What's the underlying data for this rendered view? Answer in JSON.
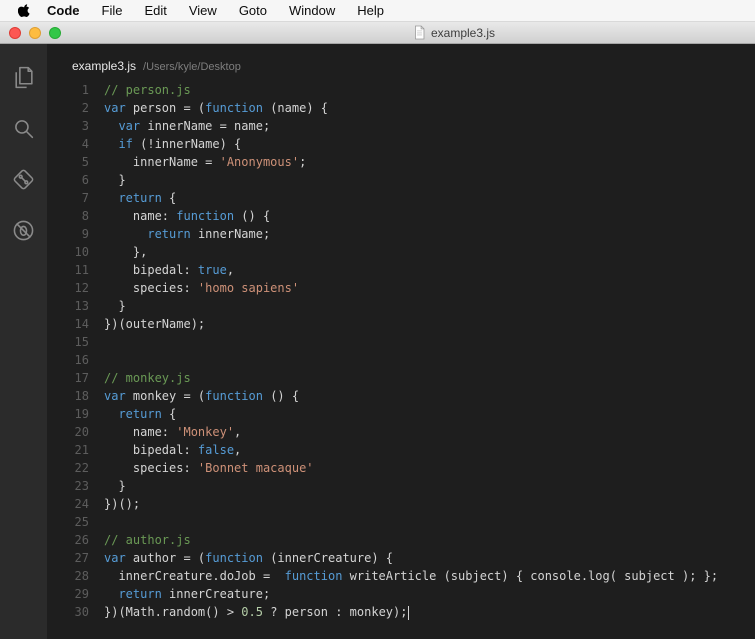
{
  "colors": {
    "editor_bg": "#1e1e1e",
    "activity_bar_bg": "#2b2b2b",
    "line_number": "#5d5d5d",
    "plain": "#d4d4d4",
    "keyword": "#569cd6",
    "string": "#ce9178",
    "comment": "#6a9955",
    "number": "#b5cea8",
    "traffic_red": "#fc5753",
    "traffic_yellow": "#fdbc40",
    "traffic_green": "#33c748"
  },
  "menu_bar": {
    "app_name": "Code",
    "items": [
      "File",
      "Edit",
      "View",
      "Goto",
      "Window",
      "Help"
    ]
  },
  "window": {
    "title": "example3.js"
  },
  "activity_bar": {
    "icons": [
      "explorer",
      "search",
      "git",
      "debug"
    ]
  },
  "editor": {
    "file_name": "example3.js",
    "file_path": "/Users/kyle/Desktop",
    "cursor_line": 30,
    "lines": [
      {
        "n": 1,
        "tokens": [
          [
            "c",
            "// person.js"
          ]
        ]
      },
      {
        "n": 2,
        "tokens": [
          [
            "k",
            "var"
          ],
          [
            "p",
            " person = ("
          ],
          [
            "k",
            "function"
          ],
          [
            "p",
            " (name) {"
          ]
        ]
      },
      {
        "n": 3,
        "tokens": [
          [
            "p",
            "  "
          ],
          [
            "k",
            "var"
          ],
          [
            "p",
            " innerName = name;"
          ]
        ]
      },
      {
        "n": 4,
        "tokens": [
          [
            "p",
            "  "
          ],
          [
            "k",
            "if"
          ],
          [
            "p",
            " (!innerName) {"
          ]
        ]
      },
      {
        "n": 5,
        "tokens": [
          [
            "p",
            "    innerName = "
          ],
          [
            "s",
            "'Anonymous'"
          ],
          [
            "p",
            ";"
          ]
        ]
      },
      {
        "n": 6,
        "tokens": [
          [
            "p",
            "  }"
          ]
        ]
      },
      {
        "n": 7,
        "tokens": [
          [
            "p",
            "  "
          ],
          [
            "k",
            "return"
          ],
          [
            "p",
            " {"
          ]
        ]
      },
      {
        "n": 8,
        "tokens": [
          [
            "p",
            "    name: "
          ],
          [
            "k",
            "function"
          ],
          [
            "p",
            " () {"
          ]
        ]
      },
      {
        "n": 9,
        "tokens": [
          [
            "p",
            "      "
          ],
          [
            "k",
            "return"
          ],
          [
            "p",
            " innerName;"
          ]
        ]
      },
      {
        "n": 10,
        "tokens": [
          [
            "p",
            "    },"
          ]
        ]
      },
      {
        "n": 11,
        "tokens": [
          [
            "p",
            "    bipedal: "
          ],
          [
            "k",
            "true"
          ],
          [
            "p",
            ","
          ]
        ]
      },
      {
        "n": 12,
        "tokens": [
          [
            "p",
            "    species: "
          ],
          [
            "s",
            "'homo sapiens'"
          ]
        ]
      },
      {
        "n": 13,
        "tokens": [
          [
            "p",
            "  }"
          ]
        ]
      },
      {
        "n": 14,
        "tokens": [
          [
            "p",
            "})(outerName);"
          ]
        ]
      },
      {
        "n": 15,
        "tokens": []
      },
      {
        "n": 16,
        "tokens": []
      },
      {
        "n": 17,
        "tokens": [
          [
            "c",
            "// monkey.js"
          ]
        ]
      },
      {
        "n": 18,
        "tokens": [
          [
            "k",
            "var"
          ],
          [
            "p",
            " monkey = ("
          ],
          [
            "k",
            "function"
          ],
          [
            "p",
            " () {"
          ]
        ]
      },
      {
        "n": 19,
        "tokens": [
          [
            "p",
            "  "
          ],
          [
            "k",
            "return"
          ],
          [
            "p",
            " {"
          ]
        ]
      },
      {
        "n": 20,
        "tokens": [
          [
            "p",
            "    name: "
          ],
          [
            "s",
            "'Monkey'"
          ],
          [
            "p",
            ","
          ]
        ]
      },
      {
        "n": 21,
        "tokens": [
          [
            "p",
            "    bipedal: "
          ],
          [
            "k",
            "false"
          ],
          [
            "p",
            ","
          ]
        ]
      },
      {
        "n": 22,
        "tokens": [
          [
            "p",
            "    species: "
          ],
          [
            "s",
            "'Bonnet macaque'"
          ]
        ]
      },
      {
        "n": 23,
        "tokens": [
          [
            "p",
            "  }"
          ]
        ]
      },
      {
        "n": 24,
        "tokens": [
          [
            "p",
            "})();"
          ]
        ]
      },
      {
        "n": 25,
        "tokens": []
      },
      {
        "n": 26,
        "tokens": [
          [
            "c",
            "// author.js"
          ]
        ]
      },
      {
        "n": 27,
        "tokens": [
          [
            "k",
            "var"
          ],
          [
            "p",
            " author = ("
          ],
          [
            "k",
            "function"
          ],
          [
            "p",
            " (innerCreature) {"
          ]
        ]
      },
      {
        "n": 28,
        "tokens": [
          [
            "p",
            "  innerCreature.doJob =  "
          ],
          [
            "k",
            "function"
          ],
          [
            "p",
            " writeArticle (subject) { console.log( subject ); };"
          ]
        ]
      },
      {
        "n": 29,
        "tokens": [
          [
            "p",
            "  "
          ],
          [
            "k",
            "return"
          ],
          [
            "p",
            " innerCreature;"
          ]
        ]
      },
      {
        "n": 30,
        "tokens": [
          [
            "p",
            "})(Math.random() > "
          ],
          [
            "n",
            "0.5"
          ],
          [
            "p",
            " ? person : monkey);"
          ]
        ]
      }
    ]
  }
}
